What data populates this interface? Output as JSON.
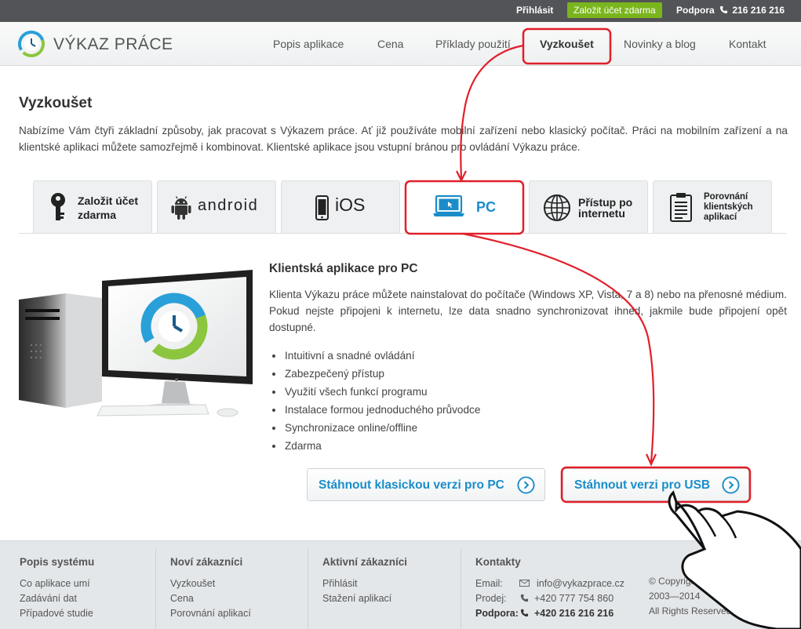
{
  "topbar": {
    "login": "Přihlásit",
    "signup": "Založit účet zdarma",
    "support_label": "Podpora",
    "support_phone": "216 216 216",
    "signup_color": "#7ab51d"
  },
  "header": {
    "logo_text": "VÝKAZ PRÁCE",
    "nav": [
      {
        "label": "Popis aplikace"
      },
      {
        "label": "Cena"
      },
      {
        "label": "Příklady použití"
      },
      {
        "label": "Vyzkoušet",
        "active": true
      },
      {
        "label": "Novinky a blog"
      },
      {
        "label": "Kontakt"
      }
    ]
  },
  "page": {
    "title": "Vyzkoušet",
    "intro": "Nabízíme Vám čtyři základní způsoby, jak pracovat s Výkazem práce. Ať již používáte mobilní zařízení nebo klasický počítač. Práci na mobilním zařízení a na klientské aplikaci můžete samozřejmě i kombinovat. Klientské aplikace jsou vstupní bránou pro ovládání Výkazu práce."
  },
  "tabs": [
    {
      "label_1": "Založit účet",
      "label_2": "zdarma",
      "icon": "key-icon"
    },
    {
      "label": "android",
      "icon": "android-icon"
    },
    {
      "label": "iOS",
      "icon": "iphone-icon"
    },
    {
      "label": "PC",
      "icon": "laptop-icon",
      "active": true
    },
    {
      "label_1": "Přístup po",
      "label_2": "internetu",
      "icon": "globe-icon"
    },
    {
      "label_1": "Porovnání",
      "label_2": "klientských",
      "label_3": "aplikací",
      "icon": "clipboard-icon"
    }
  ],
  "pc_section": {
    "title": "Klientská aplikace pro PC",
    "text": "Klienta Výkazu práce můžete nainstalovat do počítače (Windows XP, Vista, 7 a 8) nebo na přenosné médium. Pokud nejste připojeni k internetu, lze data snadno synchronizovat ihned, jakmile bude připojení opět dostupné.",
    "features": [
      "Intuitivní a snadné ovládání",
      "Zabezpečený přístup",
      "Využití všech funkcí programu",
      "Instalace formou jednoduchého průvodce",
      "Synchronizace online/offline",
      "Zdarma"
    ],
    "btn_classic": "Stáhnout klasickou verzi pro PC",
    "btn_usb": "Stáhnout verzi pro USB"
  },
  "footer": {
    "col1": {
      "title": "Popis systému",
      "links": [
        "Co aplikace umí",
        "Zadávání dat",
        "Případové studie"
      ]
    },
    "col2": {
      "title": "Noví zákazníci",
      "links": [
        "Vyzkoušet",
        "Cena",
        "Porovnání aplikací"
      ]
    },
    "col3": {
      "title": "Aktivní zákazníci",
      "links": [
        "Přihlásit",
        "Stažení aplikací"
      ]
    },
    "col4": {
      "title": "Kontakty",
      "email_label": "Email:",
      "email": "info@vykazprace.cz",
      "sales_label": "Prodej:",
      "sales_phone": "+420 777 754 860",
      "support_label": "Podpora:",
      "support_phone": "+420 216 216 216"
    },
    "copyright_1": "© Copyright",
    "copyright_2": "2003—2014",
    "copyright_3": "All Rights Reserved"
  },
  "colors": {
    "accent_blue": "#1a8dc9",
    "highlight_red": "#e0202a",
    "topbar": "#525457"
  }
}
